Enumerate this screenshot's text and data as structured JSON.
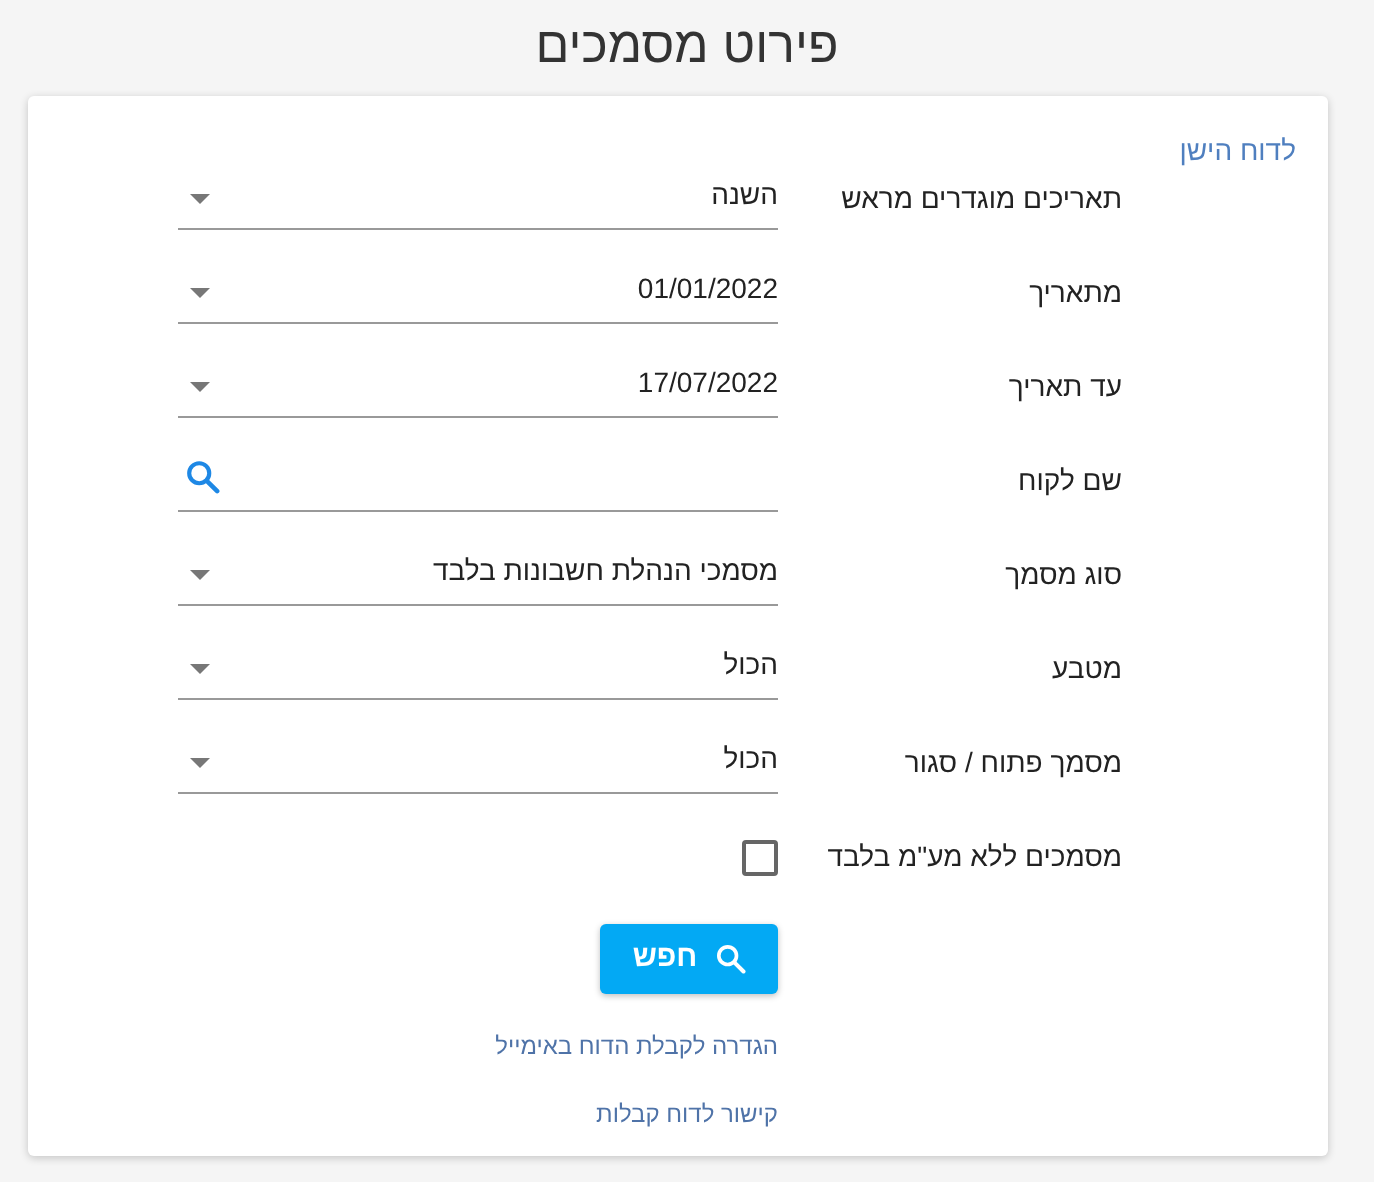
{
  "title": "פירוט מסמכים",
  "old_report_link": "לדוח הישן",
  "fields": [
    {
      "kind": "select",
      "label": "תאריכים מוגדרים מראש",
      "value": "השנה"
    },
    {
      "kind": "select",
      "label": "מתאריך",
      "value": "01/01/2022"
    },
    {
      "kind": "select",
      "label": "עד תאריך",
      "value": "17/07/2022"
    },
    {
      "kind": "search",
      "label": "שם לקוח"
    },
    {
      "kind": "select",
      "label": "סוג מסמך",
      "value": "מסמכי הנהלת חשבונות בלבד"
    },
    {
      "kind": "select",
      "label": "מטבע",
      "value": "הכול"
    },
    {
      "kind": "select",
      "label": "מסמך פתוח / סגור",
      "value": "הכול"
    },
    {
      "kind": "checkbox",
      "label": "מסמכים ללא מע\"מ בלבד",
      "checked": false
    }
  ],
  "search_button": "חפש",
  "links": [
    "הגדרה לקבלת הדוח באימייל",
    "קישור לדוח קבלות"
  ]
}
